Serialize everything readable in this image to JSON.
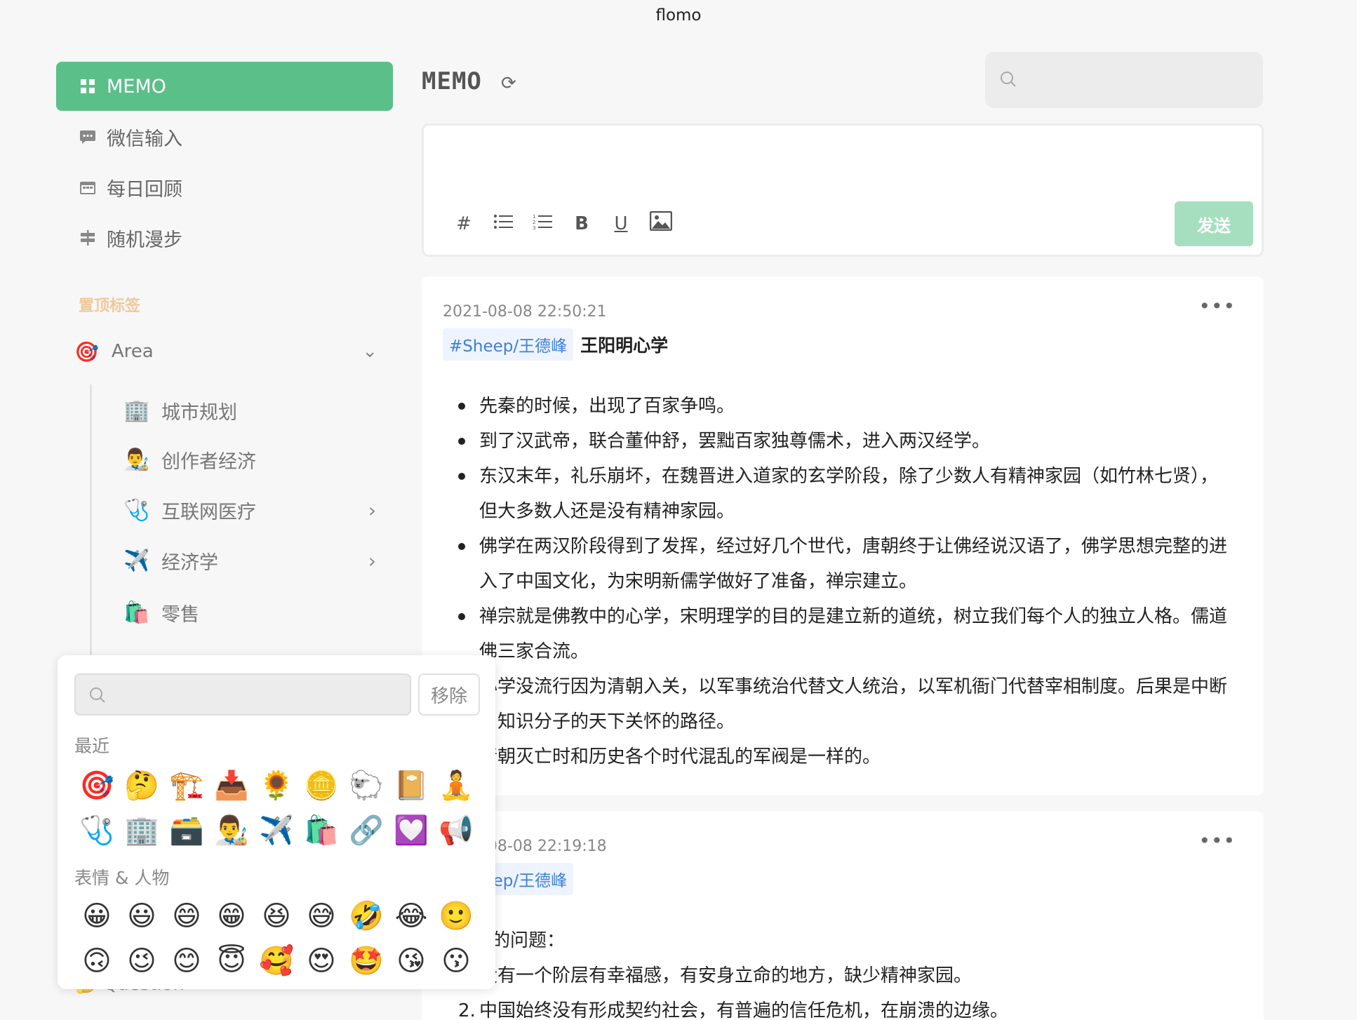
{
  "window": {
    "title": "flomo"
  },
  "sidebar": {
    "nav": [
      {
        "label": "MEMO",
        "icon": "grid-icon",
        "active": true
      },
      {
        "label": "微信输入",
        "icon": "chat-icon"
      },
      {
        "label": "每日回顾",
        "icon": "calendar-icon"
      },
      {
        "label": "随机漫步",
        "icon": "signpost-icon"
      }
    ],
    "pinned_label": "置顶标签",
    "area": {
      "emoji": "🎯",
      "label": "Area"
    },
    "sub_items": [
      {
        "emoji": "🏢",
        "label": "城市规划"
      },
      {
        "emoji": "👨‍🎨",
        "label": "创作者经济"
      },
      {
        "emoji": "🩺",
        "label": "互联网医疗"
      },
      {
        "emoji": "✈️",
        "label": "经济学"
      },
      {
        "emoji": "🛍️",
        "label": "零售"
      }
    ],
    "hidden_item": {
      "emoji": "🤔",
      "label": "Question"
    }
  },
  "header": {
    "title": "MEMO",
    "search_placeholder": ""
  },
  "editor": {
    "placeholder": "",
    "send_label": "发送",
    "tools": [
      "#",
      "≔",
      "⒈",
      "B",
      "U",
      "🖼"
    ]
  },
  "memos": [
    {
      "time": "2021-08-08 22:50:21",
      "tag": "#Sheep/王德峰",
      "heading": "王阳明心学",
      "bullets": [
        "先秦的时候，出现了百家争鸣。",
        "到了汉武帝，联合董仲舒，罢黜百家独尊儒术，进入两汉经学。",
        "东汉末年，礼乐崩坏，在魏晋进入道家的玄学阶段，除了少数人有精神家园（如竹林七贤），但大多数人还是没有精神家园。",
        "佛学在两汉阶段得到了发挥，经过好几个世代，唐朝终于让佛经说汉语了，佛学思想完整的进入了中国文化，为宋明新儒学做好了准备，禅宗建立。",
        "禅宗就是佛教中的心学，宋明理学的目的是建立新的道统，树立我们每个人的独立人格。儒道佛三家合流。",
        "心学没流行因为清朝入关，以军事统治代替文人统治，以军机衙门代替宰相制度。后果是中断了知识分子的天下关怀的路径。",
        "清朝灭亡时和历史各个时代混乱的军阀是一样的。"
      ]
    },
    {
      "time": "2021-08-08 22:19:18",
      "tag": "#Sheep/王德峰",
      "intro": "中国的问题：",
      "items": [
        "没有一个阶层有幸福感，有安身立命的地方，缺少精神家园。",
        "中国始终没有形成契约社会，有普遍的信任危机，在崩溃的边缘。"
      ]
    }
  ],
  "emoji_picker": {
    "search_placeholder": "",
    "remove_label": "移除",
    "recent_label": "最近",
    "recent": [
      "🎯",
      "🤔",
      "🏗️",
      "📥",
      "🌻",
      "🪙",
      "🐑",
      "📔",
      "🧘",
      "🩺",
      "🏢",
      "🗃️",
      "👨‍🎨",
      "✈️",
      "🛍️",
      "🔗",
      "💟",
      "📢"
    ],
    "people_label": "表情 & 人物",
    "people": [
      "😀",
      "😃",
      "😄",
      "😁",
      "😆",
      "😅",
      "🤣",
      "😂",
      "🙂",
      "🙃",
      "😉",
      "😊",
      "😇",
      "🥰",
      "😍",
      "🤩",
      "😘",
      "😗"
    ]
  }
}
